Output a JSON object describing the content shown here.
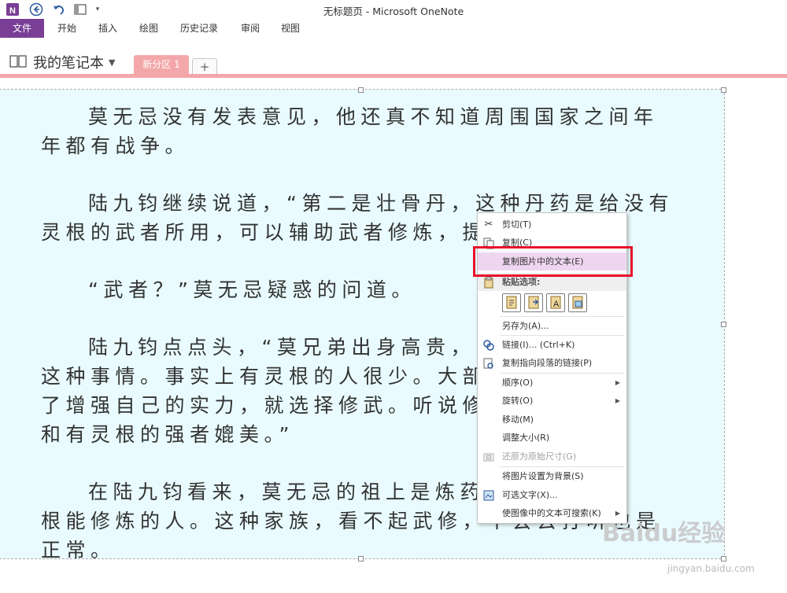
{
  "window": {
    "title": "无标题页 - Microsoft OneNote"
  },
  "ribbon": {
    "tabs": [
      "文件",
      "开始",
      "插入",
      "绘图",
      "历史记录",
      "审阅",
      "视图"
    ]
  },
  "notebook": {
    "name": "我的笔记本",
    "section": "新分区 1",
    "add": "+"
  },
  "content": {
    "paragraphs": [
      "莫无忌没有发表意见，他还真不知道周围国家之间年年都有战争。",
      "陆九钧继续说道，“第二是壮骨丹，这种丹药是给没有灵根的武者所用，可以辅助武者修炼，提升武",
      "“武者？”莫无忌疑惑的问道。",
      "陆九钧点点头，“莫兄弟出身高贵，自　　　　　　　这种事情。事实上有灵根的人很少。大部分只有　　　　　　了增强自己的实力，就选择修武。听说修武到了　　　　　　和有灵根的强者媲美。”",
      "在陆九钧看来，莫无忌的祖上是炼药师　　　　　　　根能修炼的人。这种家族，看不起武修，不会去打听也是正常。"
    ]
  },
  "context_menu": {
    "cut": "剪切(T)",
    "copy": "复制(C)",
    "copy_text": "复制图片中的文本(E)",
    "paste_header": "粘贴选项:",
    "save_as": "另存为(A)...",
    "link": "链接(I)...  (Ctrl+K)",
    "copy_link": "复制指向段落的链接(P)",
    "order": "顺序(O)",
    "rotate": "旋转(O)",
    "move": "移动(M)",
    "resize": "调整大小(R)",
    "restore": "还原为原始尺寸(G)",
    "set_bg": "将图片设置为背景(S)",
    "alt_text": "可选文字(X)...",
    "searchable": "使图像中的文本可搜索(K)"
  },
  "watermark": {
    "brand": "Baidu经验",
    "url": "jingyan.baidu.com"
  },
  "colors": {
    "file_tab": "#7a3e96",
    "section": "#f4a7a9",
    "highlight_box": "#e8132b",
    "image_bg": "#e9fbfe"
  }
}
